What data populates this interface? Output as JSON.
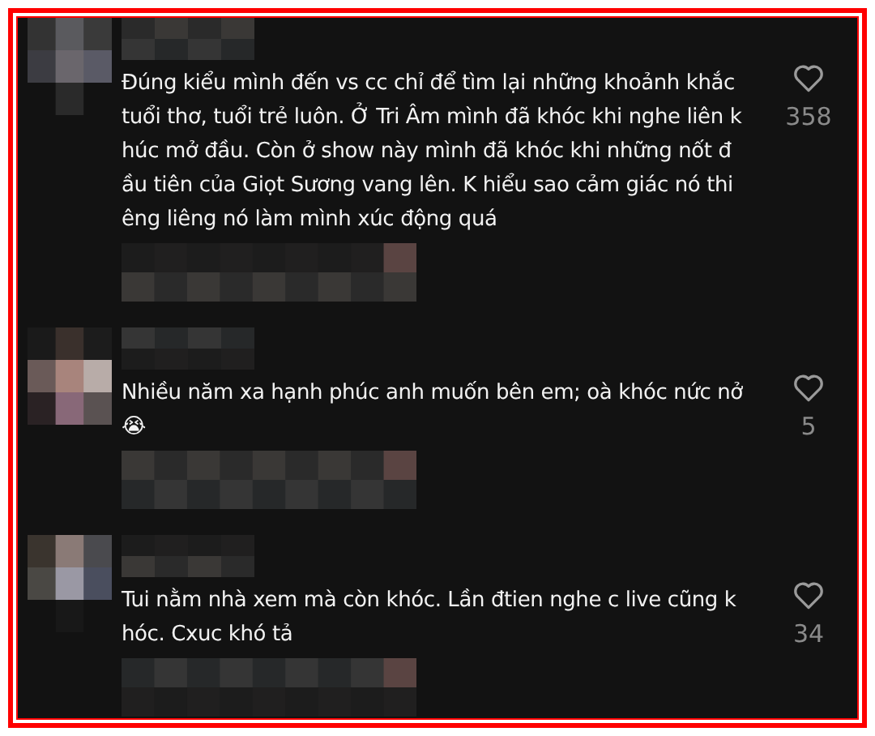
{
  "comments": [
    {
      "lines": [
        "Đúng kiểu mình đến vs cc chỉ để tìm lại những khoảnh khắc",
        "tuổi thơ, tuổi trẻ luôn. Ở Tri Âm mình đã khóc khi nghe liên k",
        "húc mở đầu. Còn ở show này mình đã khóc khi những nốt đ",
        "ầu tiên của Giọt Sương vang lên. K hiểu sao cảm giác nó thi",
        "êng liêng nó làm mình xúc động quá"
      ],
      "likes": "358"
    },
    {
      "lines": [
        "Nhiều năm xa hạnh phúc anh muốn bên em; oà khóc nức nở",
        "😭"
      ],
      "likes": "5"
    },
    {
      "lines": [
        "Tui nằm nhà xem mà còn khóc. Lần đtien nghe c live cũng k",
        "hóc. Cxuc khó tả"
      ],
      "likes": "34"
    }
  ]
}
